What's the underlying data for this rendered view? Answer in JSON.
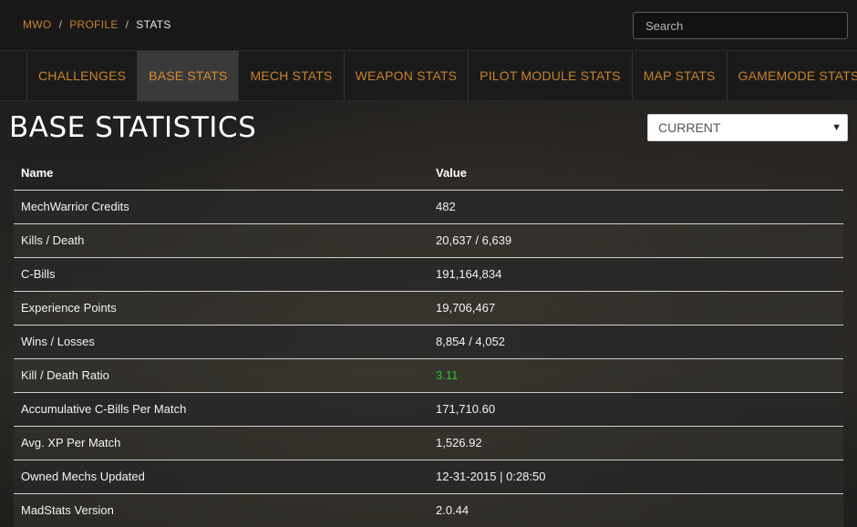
{
  "breadcrumb": {
    "items": [
      "MWO",
      "PROFILE",
      "STATS"
    ],
    "separator": "/"
  },
  "search": {
    "placeholder": "Search",
    "value": ""
  },
  "tabs": [
    {
      "label": "CHALLENGES",
      "active": false
    },
    {
      "label": "BASE STATS",
      "active": true
    },
    {
      "label": "MECH STATS",
      "active": false
    },
    {
      "label": "WEAPON STATS",
      "active": false
    },
    {
      "label": "PILOT MODULE STATS",
      "active": false
    },
    {
      "label": "MAP STATS",
      "active": false
    },
    {
      "label": "GAMEMODE STATS",
      "active": false
    }
  ],
  "page_title": "BASE STATISTICS",
  "season_select": {
    "selected": "CURRENT",
    "arrow": "▼"
  },
  "table": {
    "headers": {
      "name": "Name",
      "value": "Value"
    },
    "rows": [
      {
        "name": "MechWarrior Credits",
        "value": "482"
      },
      {
        "name": "Kills / Death",
        "value": "20,637 / 6,639"
      },
      {
        "name": "C-Bills",
        "value": "191,164,834"
      },
      {
        "name": "Experience Points",
        "value": "19,706,467"
      },
      {
        "name": "Wins / Losses",
        "value": "8,854 / 4,052"
      },
      {
        "name": "Kill / Death Ratio",
        "value": "3.11",
        "color": "#2fbf2f"
      },
      {
        "name": "Accumulative C-Bills Per Match",
        "value": "171,710.60"
      },
      {
        "name": "Avg. XP Per Match",
        "value": "1,526.92"
      },
      {
        "name": "Owned Mechs Updated",
        "value": "12-31-2015 | 0:28:50"
      },
      {
        "name": "MadStats Version",
        "value": "2.0.44"
      }
    ]
  },
  "colors": {
    "accent": "#c8822a",
    "positive": "#2fbf2f",
    "active_tab_bg": "#3a3a3a"
  }
}
